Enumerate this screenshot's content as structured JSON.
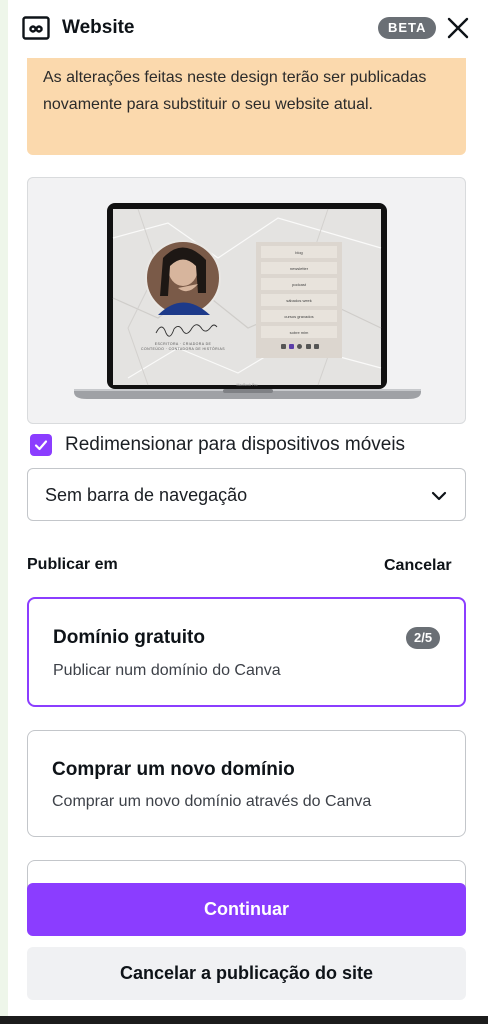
{
  "header": {
    "title": "Website",
    "beta_badge": "BETA",
    "icon": "website-icon",
    "close_icon": "close-icon"
  },
  "warning": {
    "text": "As alterações feitas neste design terão ser publicadas novamente para substituir o seu website atual."
  },
  "preview": {
    "laptop_label": "MacBook Pro",
    "site_menu": [
      "blog",
      "newsletter",
      "podcast",
      "sábados week",
      "cursos gravados",
      "sobre mim"
    ],
    "signature": "Ana Costa Lima",
    "tagline": "ESCRITORA · CRIADORA DE CONTEÚDO · CONTADORA DE HISTÓRIAS"
  },
  "resize_option": {
    "label": "Redimensionar para dispositivos móveis",
    "checked": true
  },
  "navigation_select": {
    "value": "Sem barra de navegação",
    "icon": "chevron-down-icon"
  },
  "publish": {
    "label": "Publicar em",
    "cancel_label": "Cancelar",
    "options": [
      {
        "title": "Domínio gratuito",
        "subtitle": "Publicar num domínio do Canva",
        "badge": "2/5",
        "selected": true
      },
      {
        "title": "Comprar um novo domínio",
        "subtitle": "Comprar um novo domínio através do Canva",
        "selected": false
      }
    ]
  },
  "actions": {
    "continue_label": "Continuar",
    "cancel_publish_label": "Cancelar a publicação do site"
  },
  "colors": {
    "accent": "#8b3dff",
    "warning_bg": "#fbd9ad",
    "badge_bg": "#6a6f75",
    "secondary_bg": "#f0f1f3"
  }
}
